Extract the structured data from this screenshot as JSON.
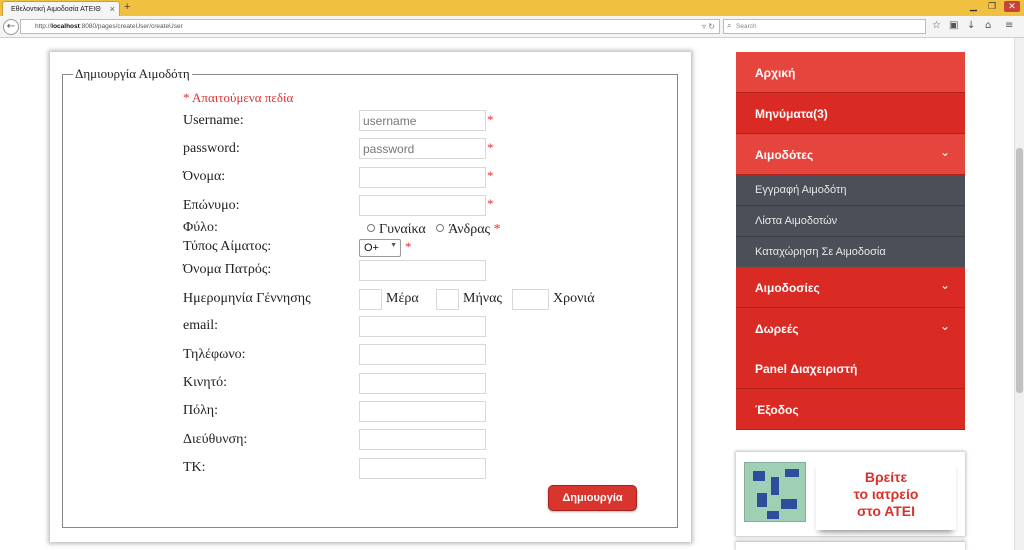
{
  "browser": {
    "tab_title": "Εθελοντική Αιμοδοσία ΑΤΕΙΘ",
    "tab_close": "×",
    "new_tab": "+",
    "url_prefix": "http://",
    "url_host": "localhost",
    "url_path": ":8080/pages/createUser/createUser",
    "search_placeholder": "Search"
  },
  "form": {
    "legend": "Δημιουργία Αιμοδότη",
    "required_note": "* Απαιτούμενα πεδία",
    "required_mark": "*",
    "fields": {
      "username": {
        "label": "Username:",
        "placeholder": "username"
      },
      "password": {
        "label": "password:",
        "placeholder": "password"
      },
      "first_name": {
        "label": "Όνομα:"
      },
      "last_name": {
        "label": "Επώνυμο:"
      },
      "gender": {
        "label": "Φύλο:",
        "options": [
          "Γυναίκα",
          "Άνδρας"
        ]
      },
      "blood_type": {
        "label": "Τύπος Αίματος:",
        "selected": "O+"
      },
      "father_name": {
        "label": "Όνομα Πατρός:"
      },
      "birth_date": {
        "label": "Ημερομηνία Γέννησης",
        "day": "Μέρα",
        "month": "Μήνας",
        "year": "Χρονιά"
      },
      "email": {
        "label": "email:"
      },
      "phone": {
        "label": "Τηλέφωνο:"
      },
      "mobile": {
        "label": "Κινητό:"
      },
      "city": {
        "label": "Πόλη:"
      },
      "address": {
        "label": "Διεύθυνση:"
      },
      "postal_code": {
        "label": "ΤΚ:"
      }
    },
    "submit_label": "Δημιουργία"
  },
  "sidebar": {
    "items": [
      {
        "label": "Αρχική"
      },
      {
        "label": "Μηνύματα(3)"
      },
      {
        "label": "Αιμοδότες",
        "expanded": true
      },
      {
        "label": "Αιμοδοσίες"
      },
      {
        "label": "Δωρεές"
      },
      {
        "label": "Panel Διαχειριστή"
      },
      {
        "label": "Έξοδος"
      }
    ],
    "subitems": [
      {
        "label": "Εγγραφή Αιμοδότη"
      },
      {
        "label": "Λίστα Αιμοδοτών"
      },
      {
        "label": "Καταχώρηση Σε Αιμοδοσία"
      }
    ],
    "colors": {
      "menu_red": "#da2a24",
      "menu_active": "#e6453d",
      "submenu_gray": "#4b4f57"
    }
  },
  "banner": {
    "lines": [
      "Βρείτε",
      "το ιατρείο",
      "στο ΑΤΕΙ"
    ]
  }
}
